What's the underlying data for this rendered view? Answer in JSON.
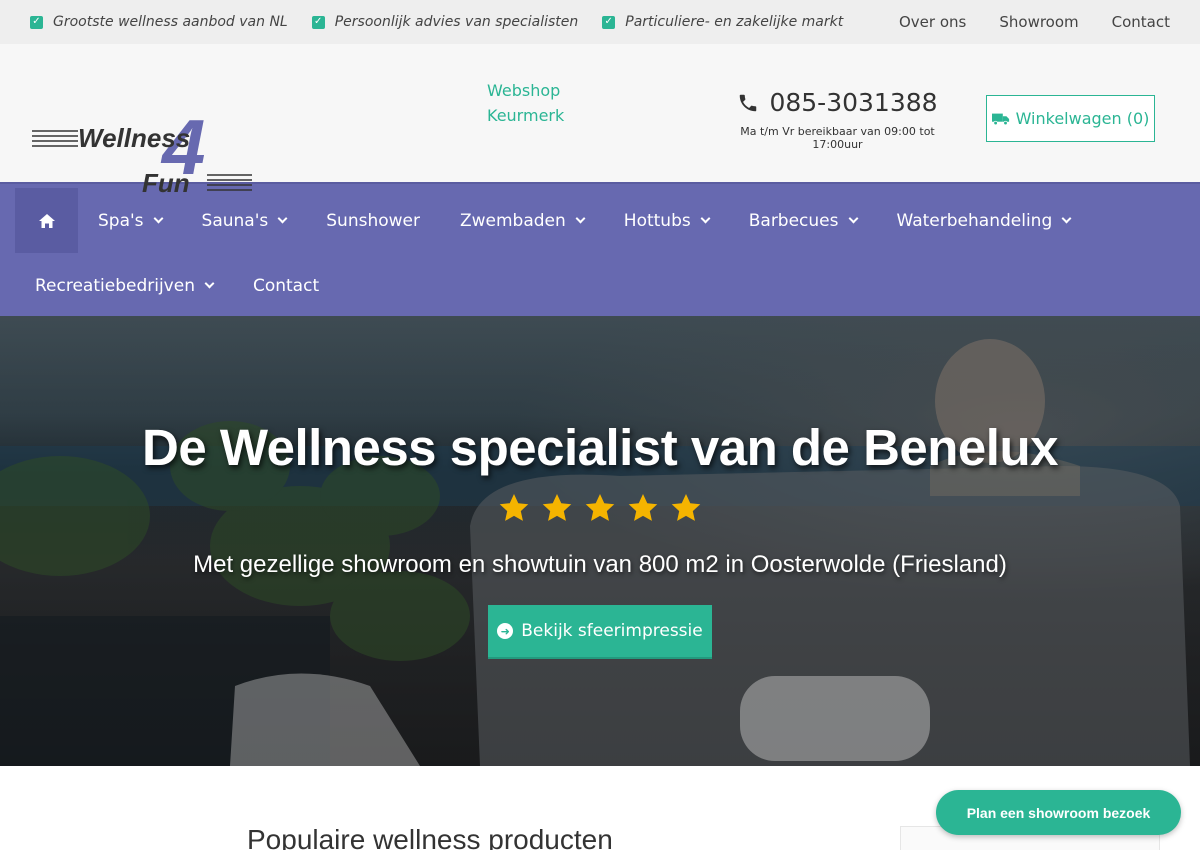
{
  "topbar": {
    "usps": [
      "Grootste wellness aanbod van NL",
      "Persoonlijk advies van specialisten",
      "Particuliere- en zakelijke markt"
    ],
    "links": [
      "Over ons",
      "Showroom",
      "Contact"
    ]
  },
  "header": {
    "logo_text_1": "Wellness",
    "logo_text_2": "Fun",
    "logo_number": "4",
    "keurmerk_alt": "Webshop Keurmerk",
    "phone": "085-3031388",
    "hours": "Ma t/m Vr bereikbaar van 09:00 tot 17:00uur",
    "cart_label": "Winkelwagen (0)"
  },
  "nav": {
    "row1": [
      {
        "label": "Spa's",
        "dropdown": true
      },
      {
        "label": "Sauna's",
        "dropdown": true
      },
      {
        "label": "Sunshower",
        "dropdown": false
      },
      {
        "label": "Zwembaden",
        "dropdown": true
      },
      {
        "label": "Hottubs",
        "dropdown": true
      },
      {
        "label": "Barbecues",
        "dropdown": true
      },
      {
        "label": "Waterbehandeling",
        "dropdown": true
      }
    ],
    "row2": [
      {
        "label": "Recreatiebedrijven",
        "dropdown": true
      },
      {
        "label": "Contact",
        "dropdown": false
      }
    ]
  },
  "hero": {
    "title": "De Wellness specialist van de Benelux",
    "rating": 5,
    "subtitle": "Met gezellige showroom en showtuin van 800 m2 in Oosterwolde (Friesland)",
    "button_label": "Bekijk sfeerimpressie"
  },
  "content": {
    "heading": "Populaire wellness producten"
  },
  "floating_button": "Plan een showroom bezoek",
  "colors": {
    "accent": "#2bb594",
    "nav": "#6769b0",
    "star": "#f5b400"
  }
}
